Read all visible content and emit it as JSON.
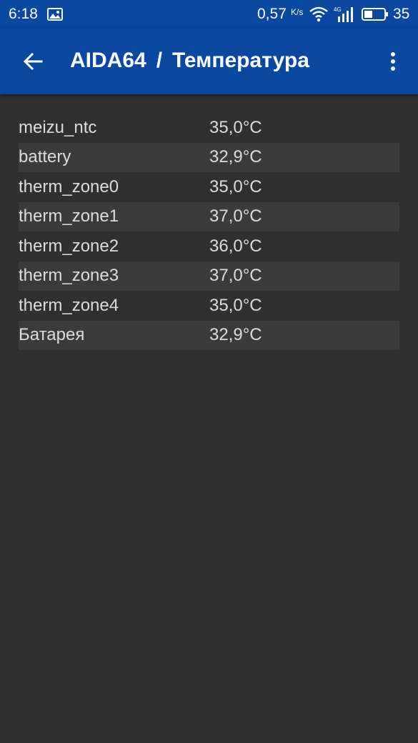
{
  "status_bar": {
    "time": "6:18",
    "net_speed": "0,57",
    "net_unit": "K/s",
    "battery_level": "35",
    "icons": [
      "image-icon",
      "wifi-icon",
      "signal-4g-icon",
      "battery-icon"
    ]
  },
  "app_bar": {
    "app_name": "AIDA64",
    "separator": "/",
    "page_title": "Температура",
    "background_color": "#0a47a1"
  },
  "sensors": [
    {
      "name": "meizu_ntc",
      "value": "35,0°C"
    },
    {
      "name": "battery",
      "value": "32,9°C"
    },
    {
      "name": "therm_zone0",
      "value": "35,0°C"
    },
    {
      "name": "therm_zone1",
      "value": "37,0°C"
    },
    {
      "name": "therm_zone2",
      "value": "36,0°C"
    },
    {
      "name": "therm_zone3",
      "value": "37,0°C"
    },
    {
      "name": "therm_zone4",
      "value": "35,0°C"
    },
    {
      "name": "Батарея",
      "value": "32,9°C"
    }
  ]
}
